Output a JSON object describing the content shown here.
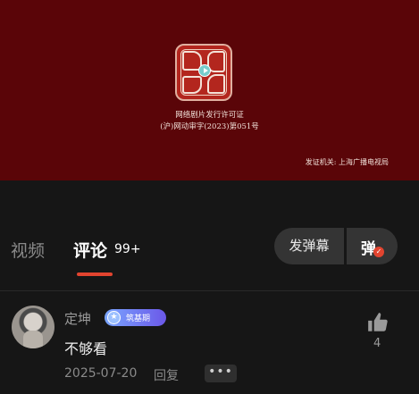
{
  "player": {
    "license_line1": "网络剧片发行许可证",
    "license_line2": "(沪)网动审字(2023)第051号",
    "issuer": "发证机关: 上海广播电视局"
  },
  "tabs": {
    "video_label": "视频",
    "comments_label": "评论",
    "comments_count": "99+",
    "danmu_send_label": "发弹幕",
    "danmu_toggle_glyph": "弹"
  },
  "comment": {
    "username": "定坤",
    "badge_label": "筑基期",
    "text": "不够看",
    "date": "2025-07-20",
    "reply_label": "回复",
    "more_label": "•••",
    "like_count": "4"
  },
  "colors": {
    "accent": "#e2442f",
    "video_bg": "#5a0508",
    "page_bg": "#161616"
  }
}
